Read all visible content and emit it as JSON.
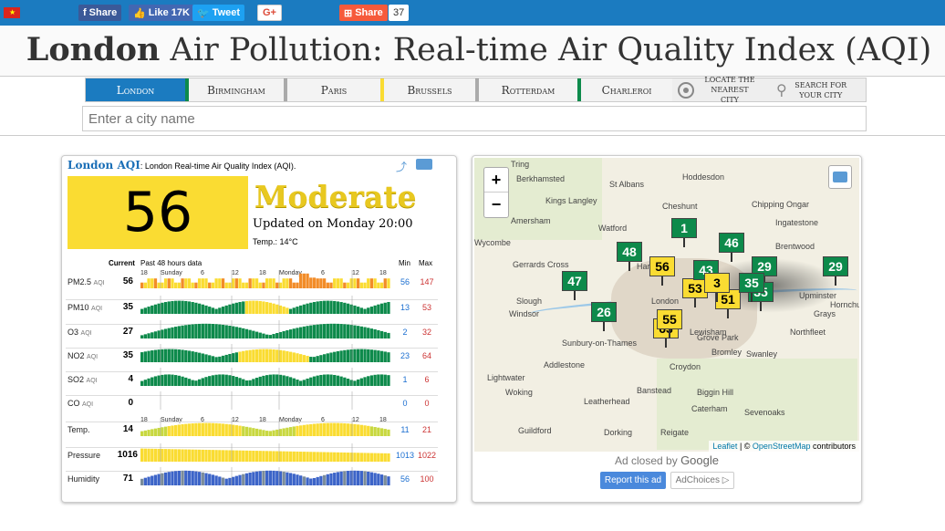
{
  "topbar": {
    "share_fb": "Share",
    "like": "Like 17K",
    "tweet": "Tweet",
    "gplus": "G+",
    "share": "Share",
    "share_count": "37"
  },
  "header": {
    "title_bold": "London",
    "title_rest": "Air Pollution: Real-time Air Quality Index (AQI)"
  },
  "nav": {
    "tabs": [
      {
        "label": "London",
        "color": "#1b7bc0"
      },
      {
        "label": "Birmingham",
        "color": "#0d8a4b"
      },
      {
        "label": "Paris",
        "color": "#aaaaaa"
      },
      {
        "label": "Brussels",
        "color": "#fadc32"
      },
      {
        "label": "Rotterdam",
        "color": "#aaaaaa"
      },
      {
        "label": "Charleroi",
        "color": "#0d8a4b"
      }
    ],
    "locate": "Locate the nearest city",
    "search_city": "Search for your city"
  },
  "search": {
    "placeholder": "Enter a city name"
  },
  "aqi": {
    "heading_link": "London AQI",
    "heading_text": ": London Real-time Air Quality Index (AQI).",
    "value": "56",
    "level": "Moderate",
    "updated": "Updated on Monday 20:00",
    "temp": "Temp.: 14°C"
  },
  "table": {
    "current_header": "Current",
    "range_header": "Past 48 hours data",
    "min_header": "Min",
    "max_header": "Max",
    "ticks_top": [
      "18",
      "Sunday",
      "6",
      "12",
      "18",
      "Monday",
      "6",
      "12",
      "18"
    ],
    "ticks_mid": [
      "18",
      "Sunday",
      "6",
      "12",
      "18",
      "Monday",
      "6",
      "12",
      "18"
    ],
    "rows": [
      {
        "name": "PM2.5",
        "unit": "AQI",
        "current": "56",
        "min": "56",
        "max": "147"
      },
      {
        "name": "PM10",
        "unit": "AQI",
        "current": "35",
        "min": "13",
        "max": "53"
      },
      {
        "name": "O3",
        "unit": "AQI",
        "current": "27",
        "min": "2",
        "max": "32"
      },
      {
        "name": "NO2",
        "unit": "AQI",
        "current": "35",
        "min": "23",
        "max": "64"
      },
      {
        "name": "SO2",
        "unit": "AQI",
        "current": "4",
        "min": "1",
        "max": "6"
      },
      {
        "name": "CO",
        "unit": "AQI",
        "current": "0",
        "min": "0",
        "max": "0"
      },
      {
        "name": "Temp.",
        "unit": "",
        "current": "14",
        "min": "11",
        "max": "21"
      },
      {
        "name": "Pressure",
        "unit": "",
        "current": "1016",
        "min": "1013",
        "max": "1022"
      },
      {
        "name": "Humidity",
        "unit": "",
        "current": "71",
        "min": "56",
        "max": "100"
      }
    ]
  },
  "map": {
    "zoom_in": "+",
    "zoom_out": "−",
    "attribution_leaflet": "Leaflet",
    "attribution_sep": " | © ",
    "attribution_osm": "OpenStreetMap",
    "attribution_rest": " contributors",
    "markers": [
      "1",
      "46",
      "48",
      "56",
      "47",
      "26",
      "29",
      "29",
      "35",
      "51",
      "53",
      "63",
      "43",
      "55",
      "3",
      "35"
    ],
    "places": [
      "Tring",
      "Berkhamsted",
      "Hoddesdon",
      "St Albans",
      "Kings Langley",
      "Cheshunt",
      "Chipping Ongar",
      "Amersham",
      "Watford",
      "Ingatestone",
      "Wycombe",
      "Brentwood",
      "Gerrards Cross",
      "Harrow",
      "Slough",
      "London",
      "Windsor",
      "Upminster",
      "Hornchurch",
      "Sunbury-on-Thames",
      "Lewisham",
      "Grays",
      "Northfleet",
      "Addlestone",
      "Grove Park",
      "Bromley",
      "Swanley",
      "Lightwater",
      "Woking",
      "Croydon",
      "Leatherhead",
      "Banstead",
      "Biggin Hill",
      "Caterham",
      "Sevenoaks",
      "Dorking",
      "Guildford",
      "Reigate"
    ],
    "ad_closed": "Ad closed by",
    "ad_google": "Google",
    "report": "Report this ad",
    "adchoices": "AdChoices"
  }
}
